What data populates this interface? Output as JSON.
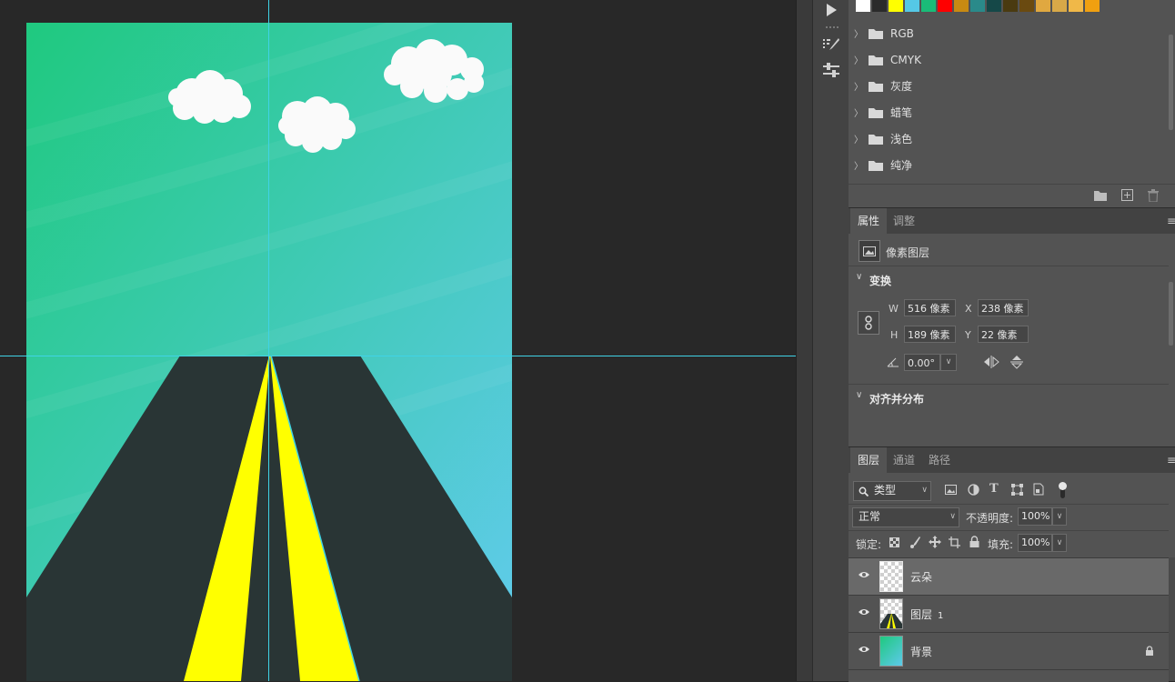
{
  "canvas": {
    "colors": {
      "sky_top": "#1fc97f",
      "sky_bottom": "#5ec9ea",
      "road": "#293535",
      "stripe": "#ffff00",
      "cloud": "#fafafa",
      "guide": "#3fd3e6"
    }
  },
  "swatches": {
    "colors": [
      "#ffffff",
      "#2b2b2b",
      "#ffff00",
      "#55c8e6",
      "#1abc78",
      "#ff0000",
      "#c88a12",
      "#2a8a8a",
      "#154848",
      "#4a3a10",
      "#6a4a10",
      "#e0a840",
      "#d8a848",
      "#f0b848",
      "#f0a010"
    ]
  },
  "swatch_groups": [
    {
      "label": "RGB"
    },
    {
      "label": "CMYK"
    },
    {
      "label": "灰度"
    },
    {
      "label": "蜡笔"
    },
    {
      "label": "浅色"
    },
    {
      "label": "纯净"
    }
  ],
  "properties": {
    "tabs": [
      "属性",
      "调整"
    ],
    "layer_kind": "像素图层",
    "transform_title": "变换",
    "w_label": "W",
    "w_value": "516 像素",
    "h_label": "H",
    "h_value": "189 像素",
    "x_label": "X",
    "x_value": "238 像素",
    "y_label": "Y",
    "y_value": "22 像素",
    "angle_value": "0.00°",
    "align_title": "对齐并分布"
  },
  "layers": {
    "tabs": [
      "图层",
      "通道",
      "路径"
    ],
    "filter_kind": "类型",
    "blend_mode": "正常",
    "opacity_label": "不透明度:",
    "opacity_value": "100%",
    "lock_label": "锁定:",
    "fill_label": "填充:",
    "fill_value": "100%",
    "items": [
      {
        "name": "云朵",
        "selected": true
      },
      {
        "name": "图层",
        "suffix": "1",
        "selected": false
      },
      {
        "name": "背景",
        "selected": false,
        "locked": true
      }
    ]
  }
}
